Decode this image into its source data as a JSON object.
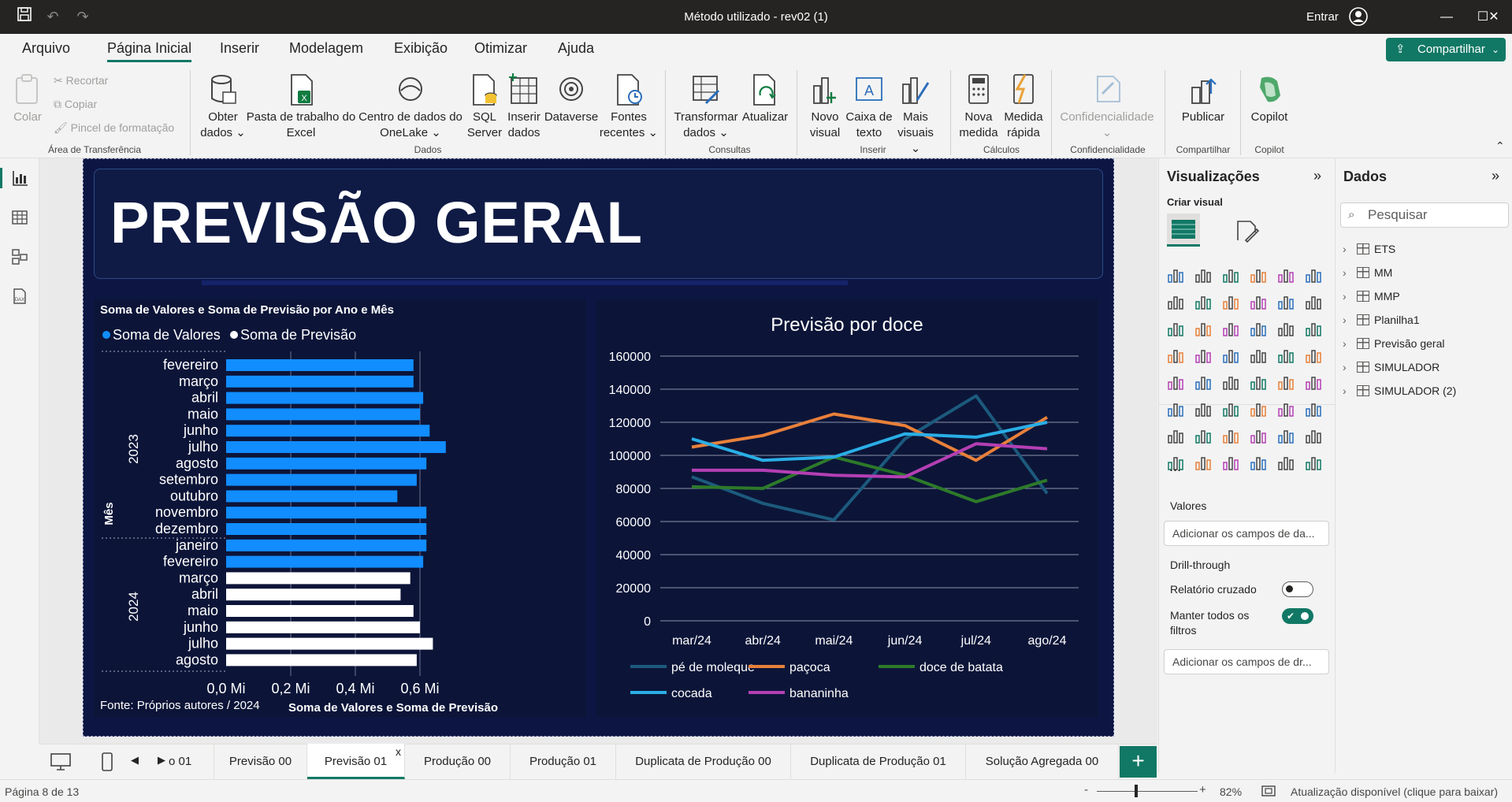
{
  "titlebar": {
    "title": "Método utilizado - rev02 (1)",
    "signin": "Entrar"
  },
  "menu": {
    "tabs": [
      "Arquivo",
      "Página Inicial",
      "Inserir",
      "Modelagem",
      "Exibição",
      "Otimizar",
      "Ajuda"
    ],
    "active": "Página Inicial",
    "share": "Compartilhar"
  },
  "ribbon": {
    "clipboard": {
      "paste": "Colar",
      "cut": "Recortar",
      "copy": "Copiar",
      "format_painter": "Pincel de formatação",
      "label": "Área de Transferência"
    },
    "data": {
      "get_data": "Obter dados",
      "excel": "Pasta de trabalho do Excel",
      "onelake": "Centro de dados do OneLake",
      "sql": "SQL Server",
      "enter": "Inserir dados",
      "dataverse": "Dataverse",
      "recent": "Fontes recentes",
      "label": "Dados"
    },
    "queries": {
      "transform": "Transformar dados",
      "refresh": "Atualizar",
      "label": "Consultas"
    },
    "insert": {
      "new_visual": "Novo visual",
      "text_box": "Caixa de texto",
      "more_visuals": "Mais visuais",
      "label": "Inserir"
    },
    "calc": {
      "new_measure": "Nova medida",
      "quick_measure": "Medida rápida",
      "label": "Cálculos"
    },
    "sensitivity": {
      "button": "Confidencialidade",
      "label": "Confidencialidade"
    },
    "share": {
      "publish": "Publicar",
      "label": "Compartilhar"
    },
    "copilot": {
      "button": "Copilot",
      "label": "Copilot"
    }
  },
  "report": {
    "title": "PREVISÃO GERAL",
    "source": "Fonte: Próprios autores / 2024"
  },
  "bar_chart": {
    "title": "Soma de Valores e Soma de Previsão por Ano e Mês",
    "legend": [
      "Soma de Valores",
      "Soma de Previsão"
    ],
    "ylabel": "Mês",
    "xlabel": "Soma de Valores e Soma de Previsão",
    "xticks": [
      "0,0 Mi",
      "0,2 Mi",
      "0,4 Mi",
      "0,6 Mi"
    ],
    "years": [
      "2023",
      "2024"
    ]
  },
  "line_chart": {
    "title": "Previsão por doce",
    "yticks": [
      "160000",
      "140000",
      "120000",
      "100000",
      "80000",
      "60000",
      "40000",
      "20000",
      "0"
    ],
    "legend": [
      "pé de moleque",
      "paçoca",
      "doce de batata",
      "cocada",
      "bananinha"
    ]
  },
  "chart_data": [
    {
      "type": "bar",
      "title": "Soma de Valores e Soma de Previsão por Ano e Mês",
      "xlabel": "Soma de Valores e Soma de Previsão",
      "ylabel": "Mês",
      "xlim": [
        0,
        0.65
      ],
      "categories": [
        "fevereiro",
        "março",
        "abril",
        "maio",
        "junho",
        "julho",
        "agosto",
        "setembro",
        "outubro",
        "novembro",
        "dezembro",
        "janeiro",
        "fevereiro",
        "março",
        "abril",
        "maio",
        "junho",
        "julho",
        "agosto"
      ],
      "year": [
        "2023",
        "2023",
        "2023",
        "2023",
        "2023",
        "2023",
        "2023",
        "2023",
        "2023",
        "2023",
        "2023",
        "2024",
        "2024",
        "2024",
        "2024",
        "2024",
        "2024",
        "2024",
        "2024"
      ],
      "series": [
        {
          "name": "Soma de Valores",
          "color": "#118dff",
          "values": [
            0.58,
            0.58,
            0.61,
            0.6,
            0.63,
            0.68,
            0.62,
            0.59,
            0.53,
            0.62,
            0.62,
            0.62,
            0.61,
            null,
            null,
            null,
            null,
            null,
            null
          ]
        },
        {
          "name": "Soma de Previsão",
          "color": "#ffffff",
          "values": [
            null,
            null,
            null,
            null,
            null,
            null,
            null,
            null,
            null,
            null,
            null,
            null,
            null,
            0.57,
            0.54,
            0.58,
            0.6,
            0.64,
            0.59
          ]
        }
      ]
    },
    {
      "type": "line",
      "title": "Previsão por doce",
      "ylim": [
        0,
        160000
      ],
      "x": [
        "mar/24",
        "abr/24",
        "mai/24",
        "jun/24",
        "jul/24",
        "ago/24"
      ],
      "series": [
        {
          "name": "pé de moleque",
          "color": "#1c5a7d",
          "values": [
            87000,
            71000,
            61000,
            110000,
            136000,
            77000
          ]
        },
        {
          "name": "paçoca",
          "color": "#e8803a",
          "values": [
            105000,
            112000,
            125000,
            118000,
            97000,
            123000
          ]
        },
        {
          "name": "doce de batata",
          "color": "#2d7a2a",
          "values": [
            81000,
            80000,
            99000,
            88000,
            72000,
            85000
          ]
        },
        {
          "name": "cocada",
          "color": "#2aaee6",
          "values": [
            110000,
            97000,
            99000,
            113000,
            111000,
            120000
          ]
        },
        {
          "name": "bananinha",
          "color": "#b43fb4",
          "values": [
            91000,
            91000,
            88000,
            87000,
            107000,
            104000
          ]
        }
      ]
    }
  ],
  "visualizations": {
    "title": "Visualizações",
    "build": "Criar visual",
    "values_label": "Valores",
    "values_placeholder": "Adicionar os campos de da...",
    "drill_label": "Drill-through",
    "cross_report": "Relatório cruzado",
    "keep_filters": "Manter todos os filtros",
    "drill_placeholder": "Adicionar os campos de dr...",
    "more": "..."
  },
  "data_pane": {
    "title": "Dados",
    "search_placeholder": "Pesquisar",
    "tables": [
      "ETS",
      "MM",
      "MMP",
      "Planilha1",
      "Previsão geral",
      "SIMULADOR",
      "SIMULADOR (2)"
    ]
  },
  "pages": {
    "tabs": [
      "o 01",
      "Previsão 00",
      "Previsão 01",
      "Produção 00",
      "Produção 01",
      "Duplicata de Produção 00",
      "Duplicata de Produção 01",
      "Solução Agregada 00"
    ],
    "active": "Previsão 01",
    "close": "x",
    "add": "+"
  },
  "status": {
    "page": "Página 8 de 13",
    "zoom": "82%",
    "update": "Atualização disponível (clique para baixar)"
  }
}
